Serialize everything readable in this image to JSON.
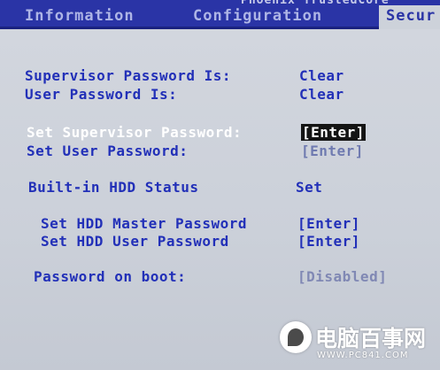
{
  "menubar": {
    "product_title": "Phoenix TrustedCore",
    "tabs": [
      {
        "label": "Information",
        "active": false
      },
      {
        "label": "Configuration",
        "active": false
      },
      {
        "label": "Secur",
        "active": true
      }
    ]
  },
  "security": {
    "supervisor_password_status": {
      "label": "Supervisor Password Is:",
      "value": "Clear"
    },
    "user_password_status": {
      "label": "User Password Is:",
      "value": "Clear"
    },
    "set_supervisor_password": {
      "label": "Set Supervisor Password:",
      "value": "[Enter]"
    },
    "set_user_password": {
      "label": "Set User Password:",
      "value": "[Enter]"
    },
    "hdd_status": {
      "label": "Built-in HDD Status",
      "value": "Set"
    },
    "set_hdd_master_password": {
      "label": "Set HDD Master Password",
      "value": "[Enter]"
    },
    "set_hdd_user_password": {
      "label": "Set HDD User Password",
      "value": "[Enter]"
    },
    "password_on_boot": {
      "label": "Password on boot:",
      "value": "[Disabled]"
    }
  },
  "watermark": {
    "text": "电脑百事网",
    "sub": "WWW.PC841.COM",
    "icon": "leaf-logo-icon"
  },
  "colors": {
    "menubar_bg": "#2a34a6",
    "panel_bg": "#cdd2da",
    "item_text": "#2230b8",
    "selected_text": "#ffffff",
    "selected_value_bg": "#141414"
  }
}
